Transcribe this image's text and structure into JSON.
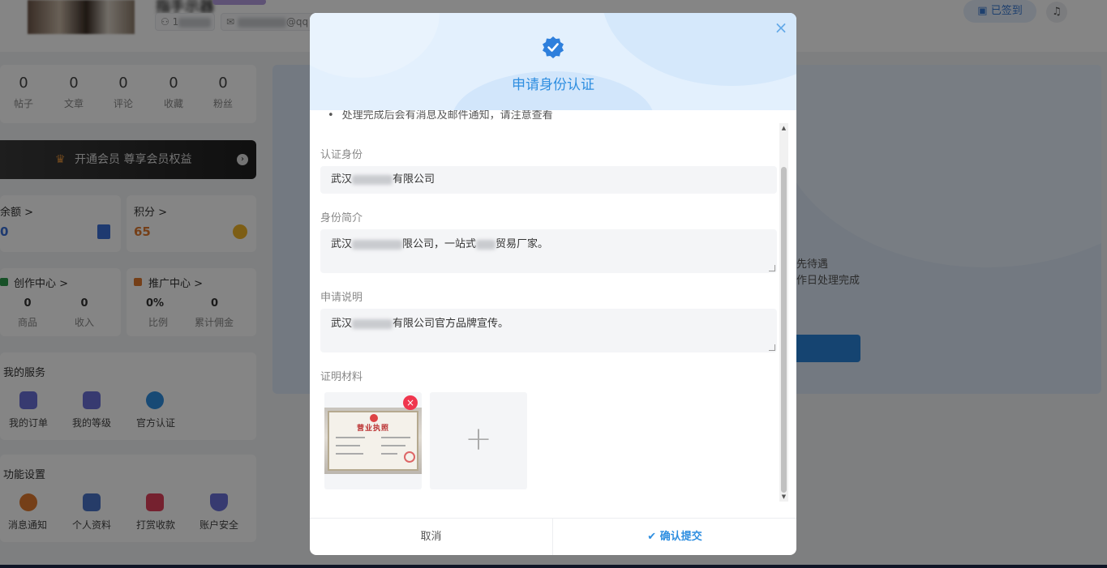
{
  "profile": {
    "name": "指手示器",
    "phone_label": "1",
    "email_label": "@qq"
  },
  "header": {
    "signed_label": "已签到",
    "bell_icon": "bell-icon"
  },
  "stats": [
    {
      "value": "0",
      "label": "帖子"
    },
    {
      "value": "0",
      "label": "文章"
    },
    {
      "value": "0",
      "label": "评论"
    },
    {
      "value": "0",
      "label": "收藏"
    },
    {
      "value": "0",
      "label": "粉丝"
    }
  ],
  "vip": {
    "label": "开通会员 尊享会员权益"
  },
  "wallet": {
    "balance_label": "余额 >",
    "balance_value": "0",
    "points_label": "积分 >",
    "points_value": "65"
  },
  "creation": {
    "title": "创作中心 >",
    "items": [
      {
        "value": "0",
        "label": "商品"
      },
      {
        "value": "0",
        "label": "收入"
      }
    ]
  },
  "promotion": {
    "title": "推广中心 >",
    "items": [
      {
        "value": "0%",
        "label": "比例"
      },
      {
        "value": "0",
        "label": "累计佣金"
      }
    ]
  },
  "services": {
    "title": "我的服务",
    "items": [
      {
        "label": "我的订单"
      },
      {
        "label": "我的等级"
      },
      {
        "label": "官方认证"
      }
    ]
  },
  "settings": {
    "title": "功能设置",
    "items": [
      {
        "label": "消息通知"
      },
      {
        "label": "个人资料"
      },
      {
        "label": "打赏收款"
      },
      {
        "label": "账户安全"
      }
    ]
  },
  "background_text": {
    "line1": "先待遇",
    "line2": "作日处理完成"
  },
  "modal": {
    "title": "申请身份认证",
    "close": "×",
    "note": "处理完成后会有消息及邮件通知，请注意查看",
    "fields": {
      "identity_label": "认证身份",
      "identity_value_prefix": "武汉",
      "identity_value_suffix": "有限公司",
      "intro_label": "身份简介",
      "intro_value_prefix": "武汉",
      "intro_value_mid": "限公司，一站式",
      "intro_value_suffix": "贸易厂家。",
      "desc_label": "申请说明",
      "desc_value_prefix": "武汉",
      "desc_value_suffix": "有限公司官方品牌宣传。",
      "material_label": "证明材料"
    },
    "license_title": "营业执照",
    "delete_icon": "×",
    "add_icon": "+",
    "cancel_label": "取消",
    "confirm_label": "确认提交",
    "confirm_icon": "✔"
  }
}
